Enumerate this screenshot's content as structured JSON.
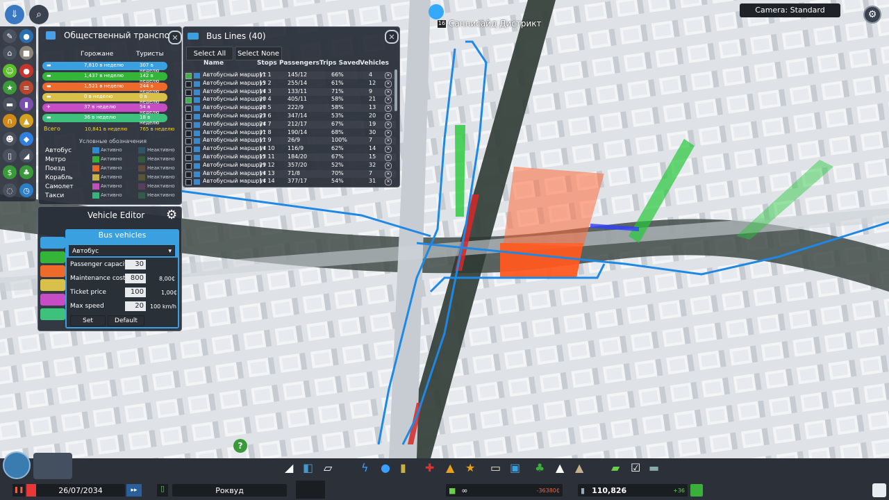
{
  "header": {
    "district_name": "Саннисайд Дистрикт",
    "district_badge": "16",
    "camera_label": "Camera: Standard",
    "colors": {
      "route_blue": "#1e88e5",
      "accent_orange": "#ff5a1f"
    }
  },
  "public_transport": {
    "title": "Общественный транспорт",
    "col_citizens": "Горожане",
    "col_tourists": "Туристы",
    "rows": [
      {
        "icon": "bus-icon",
        "color": "#3aa0e0",
        "citizens": "7,810 в неделю",
        "tourists": "307 в неделю"
      },
      {
        "icon": "metro-icon",
        "color": "#35b43a",
        "citizens": "1,437 в неделю",
        "tourists": "142 в неделю"
      },
      {
        "icon": "train-icon",
        "color": "#ee6a2a",
        "citizens": "1,521 в неделю",
        "tourists": "244 в неделю"
      },
      {
        "icon": "ship-icon",
        "color": "#d9c04a",
        "citizens": "0 в неделю",
        "tourists": "0 в неделю"
      },
      {
        "icon": "plane-icon",
        "color": "#c64dc3",
        "citizens": "37 в неделю",
        "tourists": "54 в неделю"
      },
      {
        "icon": "taxi-icon",
        "color": "#3fc17e",
        "citizens": "36 в неделю",
        "tourists": "18 в неделю"
      }
    ],
    "total_label": "Всего",
    "total_citizens": "10,841 в неделю",
    "total_tourists": "765 в неделю",
    "legend_title": "Условные обозначения",
    "legend": [
      {
        "name": "Автобус",
        "active": "Активно",
        "inactive": "Неактивно",
        "color": "#2f8ad4",
        "inactive_color": "#2f5566"
      },
      {
        "name": "Метро",
        "active": "Активно",
        "inactive": "Неактивно",
        "color": "#34b03a",
        "inactive_color": "#35573a"
      },
      {
        "name": "Поезд",
        "active": "Активно",
        "inactive": "Неактивно",
        "color": "#e26a2b",
        "inactive_color": "#5e4a3a"
      },
      {
        "name": "Корабль",
        "active": "Активно",
        "inactive": "Неактивно",
        "color": "#c8b046",
        "inactive_color": "#5a5436"
      },
      {
        "name": "Самолет",
        "active": "Активно",
        "inactive": "Неактивно",
        "color": "#c04fb8",
        "inactive_color": "#56405a"
      },
      {
        "name": "Такси",
        "active": "Активно",
        "inactive": "Неактивно",
        "color": "#36b47c",
        "inactive_color": "#355a4a"
      }
    ]
  },
  "bus_lines": {
    "title": "Bus Lines (40)",
    "select_all": "Select All",
    "select_none": "Select None",
    "columns": {
      "name": "Name",
      "stops": "Stops",
      "passengers": "Passengers",
      "trips_saved": "Trips Saved",
      "vehicles": "Vehicles"
    },
    "rows": [
      {
        "checked": true,
        "name": "Автобусный маршрут 1",
        "stops": "11",
        "passengers": "145/12",
        "trips": "66%",
        "vehicles": "4"
      },
      {
        "checked": false,
        "name": "Автобусный маршрут 2",
        "stops": "15",
        "passengers": "255/14",
        "trips": "61%",
        "vehicles": "12"
      },
      {
        "checked": false,
        "name": "Автобусный маршрут 3",
        "stops": "14",
        "passengers": "133/11",
        "trips": "71%",
        "vehicles": "9"
      },
      {
        "checked": true,
        "name": "Автобусный маршрут 4",
        "stops": "20",
        "passengers": "405/11",
        "trips": "58%",
        "vehicles": "21"
      },
      {
        "checked": false,
        "name": "Автобусный маршрут 5",
        "stops": "20",
        "passengers": "222/9",
        "trips": "58%",
        "vehicles": "13"
      },
      {
        "checked": false,
        "name": "Автобусный маршрут 6",
        "stops": "23",
        "passengers": "347/14",
        "trips": "53%",
        "vehicles": "20"
      },
      {
        "checked": false,
        "name": "Автобусный маршрут 7",
        "stops": "24",
        "passengers": "212/17",
        "trips": "67%",
        "vehicles": "19"
      },
      {
        "checked": false,
        "name": "Автобусный маршрут 8",
        "stops": "31",
        "passengers": "190/14",
        "trips": "68%",
        "vehicles": "30"
      },
      {
        "checked": false,
        "name": "Автобусный маршрут 9",
        "stops": "11",
        "passengers": "26/9",
        "trips": "100%",
        "vehicles": "7"
      },
      {
        "checked": false,
        "name": "Автобусный маршрут 10",
        "stops": "14",
        "passengers": "116/9",
        "trips": "62%",
        "vehicles": "14"
      },
      {
        "checked": false,
        "name": "Автобусный маршрут 11",
        "stops": "15",
        "passengers": "184/20",
        "trips": "67%",
        "vehicles": "15"
      },
      {
        "checked": false,
        "name": "Автобусный маршрут 12",
        "stops": "29",
        "passengers": "357/20",
        "trips": "52%",
        "vehicles": "32"
      },
      {
        "checked": false,
        "name": "Автобусный маршрут 13",
        "stops": "14",
        "passengers": "71/8",
        "trips": "70%",
        "vehicles": "7"
      },
      {
        "checked": false,
        "name": "Автобусный маршрут 14",
        "stops": "14",
        "passengers": "377/17",
        "trips": "54%",
        "vehicles": "31"
      }
    ]
  },
  "vehicle_editor": {
    "title": "Vehicle Editor",
    "subtitle": "Bus vehicles",
    "selected_vehicle": "Автобус",
    "fields": [
      {
        "label": "Passenger capacity",
        "value": "30",
        "extra": ""
      },
      {
        "label": "Maintenance cost",
        "value": "800",
        "extra": "8,00₵"
      },
      {
        "label": "Ticket price",
        "value": "100",
        "extra": "1,00₵"
      },
      {
        "label": "Max speed",
        "value": "20",
        "extra": "100 km/h"
      }
    ],
    "set_label": "Set",
    "default_label": "Default"
  },
  "bottom": {
    "date": "26/07/2034",
    "city_name": "Роквуд",
    "money_symbol": "∞",
    "money_delta": "-36380₵",
    "population": "110,826",
    "population_delta": "+36"
  }
}
